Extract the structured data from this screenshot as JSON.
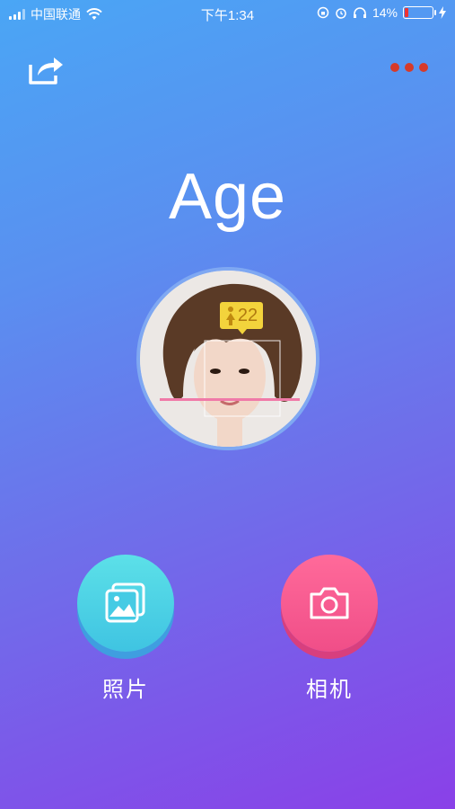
{
  "status_bar": {
    "carrier": "中国联通",
    "time": "下午1:34",
    "battery_percent": "14%",
    "battery_level": 0.14
  },
  "header": {
    "share_icon": "share-icon",
    "more_icon": "more-dots-icon",
    "more_color": "#d63a2a"
  },
  "title": "Age",
  "preview": {
    "age_value": "22",
    "badge_color": "#f3d33c"
  },
  "actions": {
    "photos_label": "照片",
    "camera_label": "相机",
    "photos_color": "#4fd3e6",
    "camera_color": "#f2578f"
  }
}
